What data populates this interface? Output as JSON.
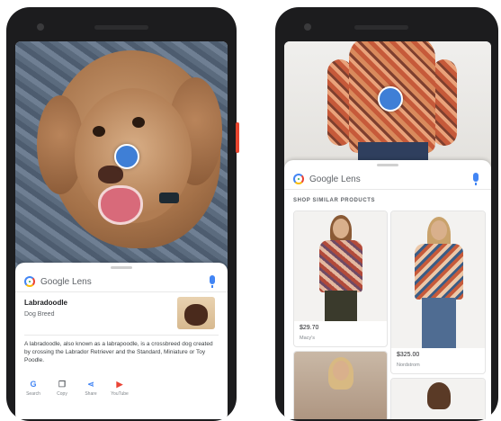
{
  "left_phone": {
    "app_name": "Google Lens",
    "result": {
      "title": "Labradoodle",
      "subtitle": "Dog Breed",
      "description": "A labradoodle, also known as a labrapoodle, is a crossbreed dog created by crossing the Labrador Retriever and the Standard, Miniature or Toy Poodle."
    },
    "actions": [
      {
        "label": "Search",
        "icon": "google-g-icon",
        "glyph": "G",
        "color": "#4285f4"
      },
      {
        "label": "Copy",
        "icon": "copy-icon",
        "glyph": "❐",
        "color": "#5f6368"
      },
      {
        "label": "Share",
        "icon": "share-icon",
        "glyph": "⋖",
        "color": "#4285f4"
      },
      {
        "label": "YouTube",
        "icon": "youtube-icon",
        "glyph": "▶",
        "color": "#ea4335"
      }
    ]
  },
  "right_phone": {
    "app_name": "Google Lens",
    "section_label": "SHOP SIMILAR PRODUCTS",
    "products": [
      {
        "price": "$29.70",
        "store": "Macy's"
      },
      {
        "price": "$325.00",
        "store": "Nordstrom"
      }
    ]
  },
  "colors": {
    "lens_dot": "#3f7fd6",
    "accent_blue": "#4285f4",
    "phone_body": "#1c1c1e",
    "side_button": "#e8452f"
  }
}
